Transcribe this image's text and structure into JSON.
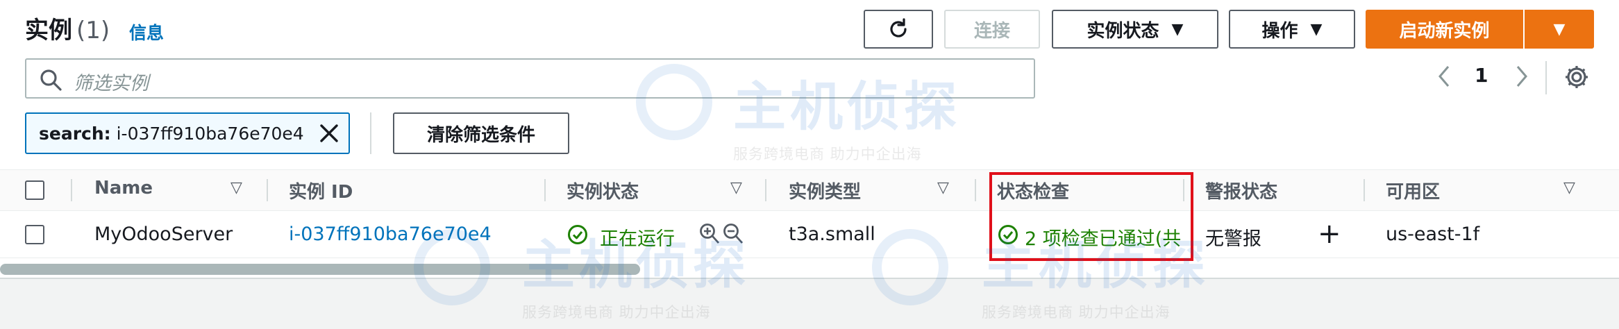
{
  "header": {
    "title": "实例",
    "count": "(1)",
    "info_link": "信息"
  },
  "toolbar": {
    "refresh_icon": "refresh-icon",
    "connect_label": "连接",
    "instance_state_label": "实例状态",
    "actions_label": "操作",
    "launch_label": "启动新实例",
    "caret": "▼"
  },
  "search": {
    "placeholder": "筛选实例"
  },
  "pagination": {
    "current_page": "1"
  },
  "filter": {
    "token_key": "search:",
    "token_value": "i-037ff910ba76e70e4",
    "clear_label": "清除筛选条件"
  },
  "table": {
    "columns": [
      "Name",
      "实例 ID",
      "实例状态",
      "实例类型",
      "状态检查",
      "警报状态",
      "可用区"
    ],
    "rows": [
      {
        "name": "MyOdooServer",
        "instance_id": "i-037ff910ba76e70e4",
        "state": "正在运行",
        "type": "t3a.small",
        "status_check": "2 项检查已通过(共",
        "alarm": "无警报",
        "alarm_add": "+",
        "zone": "us-east-1f"
      }
    ]
  },
  "watermark": {
    "brand": "主机侦探",
    "slogan": "服务跨境电商 助力中企出海"
  },
  "colors": {
    "primary": "#ec7211",
    "link": "#0073bb",
    "success": "#1d8102",
    "highlight": "#e0101a"
  }
}
